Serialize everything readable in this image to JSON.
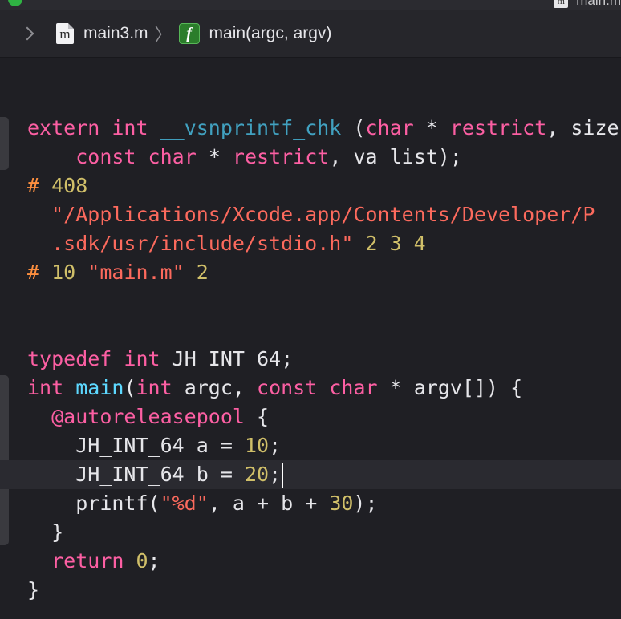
{
  "window": {
    "top_file_name": "main.m"
  },
  "jumpbar": {
    "file_icon_letter": "m",
    "file_name": "main3.m",
    "separator": "〉",
    "function_icon_letter": "f",
    "function_name": "main(argc, argv)"
  },
  "code": {
    "l1": {
      "kw": "extern",
      "t1": "int",
      "fn": "__vsnprintf_chk",
      "p1": " (",
      "t2": "char",
      "p2": " * ",
      "k2": "restrict",
      "p3": ", size"
    },
    "l2": {
      "t1": "const",
      "t2": "char",
      "p1": " * ",
      "k1": "restrict",
      "p2": ", va_list);"
    },
    "l3": {
      "dir": "#",
      "num": "408"
    },
    "l4": {
      "str": "\"/Applications/Xcode.app/Contents/Developer/P"
    },
    "l5": {
      "str": ".sdk/usr/include/stdio.h\"",
      "nums": "2 3 4"
    },
    "l6": {
      "dir": "#",
      "num": "10",
      "str": "\"main.m\"",
      "num2": "2"
    },
    "l7": {
      "kw": "typedef",
      "t1": "int",
      "rest": "JH_INT_64;"
    },
    "l8": {
      "t1": "int",
      "fn": "main",
      "p1": "(",
      "t2": "int",
      "p2": " argc, ",
      "t3": "const",
      "t4": "char",
      "p3": " * argv[]) {"
    },
    "l9": {
      "kw": "@autoreleasepool",
      "rest": " {"
    },
    "l10": {
      "p1": "JH_INT_64 a = ",
      "num": "10",
      "p2": ";"
    },
    "l11": {
      "p1": "JH_INT_64 b = ",
      "num": "20",
      "p2": ";"
    },
    "l12": {
      "p1": "printf(",
      "str": "\"%d\"",
      "p2": ", a + b + ",
      "num": "30",
      "p3": ");"
    },
    "l13": {
      "p1": "}"
    },
    "l14": {
      "kw": "return",
      "num": "0",
      "p1": ";"
    },
    "l15": {
      "p1": "}"
    }
  }
}
